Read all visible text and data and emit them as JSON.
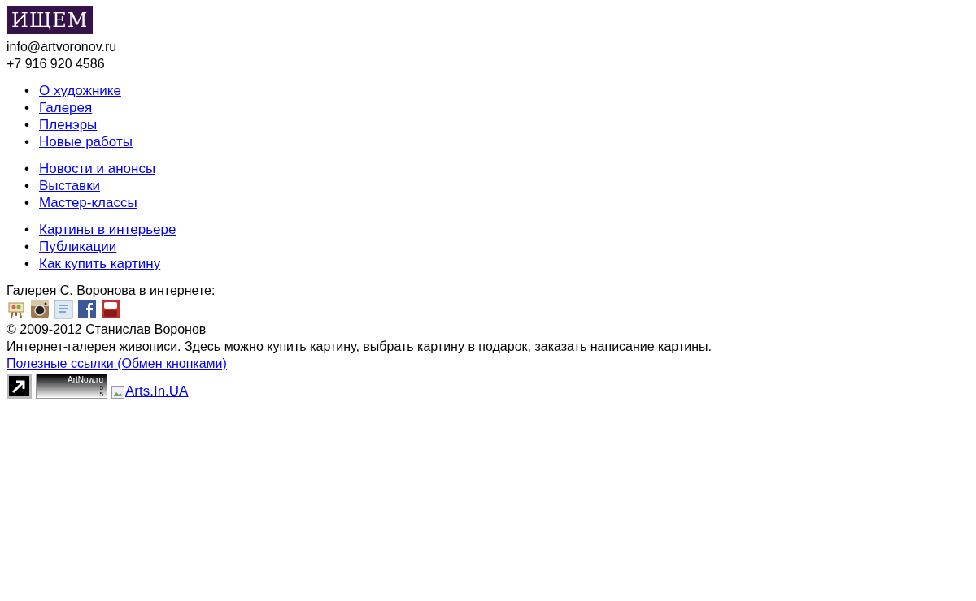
{
  "logo": {
    "text": "ИЩЕМ"
  },
  "contacts": {
    "email": "info@artvoronov.ru",
    "phone": "+7 916 920 4586"
  },
  "menu_groups": [
    {
      "items": [
        {
          "marker": "•",
          "text": "О художнике"
        },
        {
          "marker": "•",
          "text": "Галерея"
        },
        {
          "marker": "•",
          "text": "Пленэры"
        },
        {
          "marker": "•",
          "text": "Новые работы"
        }
      ]
    },
    {
      "items": [
        {
          "marker": "•",
          "text": "Новости и анонсы"
        },
        {
          "marker": "•",
          "text": "Выставки"
        },
        {
          "marker": "•",
          "text": "Мастер-классы"
        }
      ]
    },
    {
      "items": [
        {
          "marker": "•",
          "text": "Картины в интерьере"
        },
        {
          "marker": "•",
          "text": "Публикации"
        },
        {
          "marker": "•",
          "text": "Как купить картину"
        }
      ]
    }
  ],
  "social": {
    "title": "Галерея С. Воронова в интернете:",
    "icons": [
      {
        "kind": "easel"
      },
      {
        "kind": "camera"
      },
      {
        "kind": "blog"
      },
      {
        "kind": "facebook"
      },
      {
        "kind": "youtube"
      }
    ]
  },
  "copyright": "© 2009-2012 Станислав Воронов",
  "description": "Интернет-галерея живописи. Здесь можно купить картину, выбрать картину в подарок, заказать написание картины.",
  "links_title": "Полезные ссылки (Обмен кнопками)",
  "counters": {
    "artnow": {
      "title": "ArtNow.ru",
      "line_1": "5",
      "line_2": "5"
    },
    "broken_image_alt": "Arts.In.UA"
  }
}
